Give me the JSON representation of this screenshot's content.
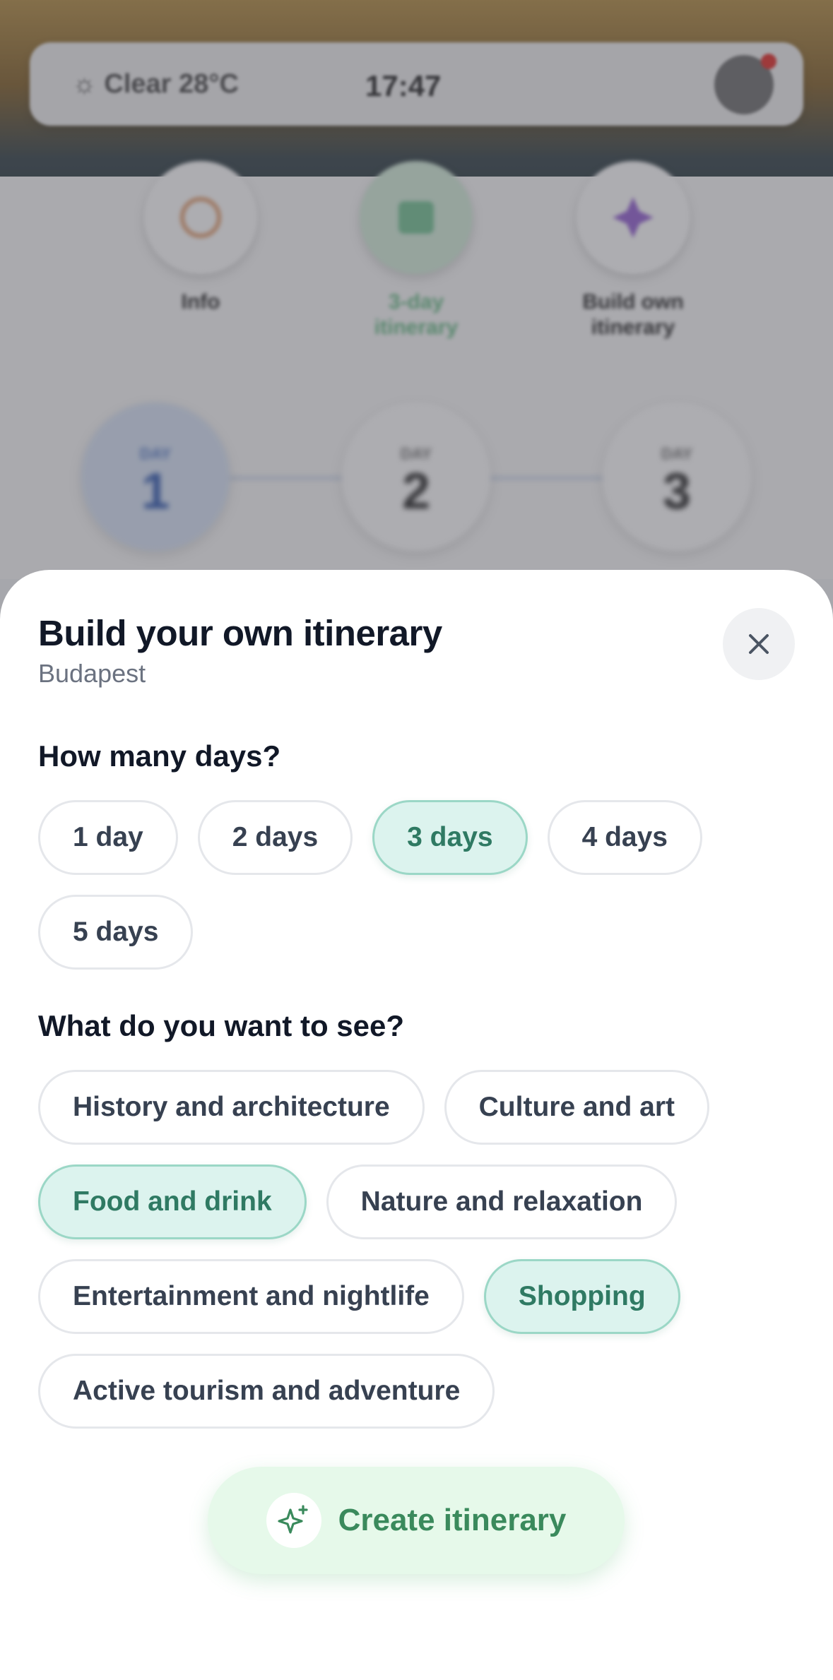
{
  "background": {
    "weather": "☼ Clear 28°C",
    "time": "17:47",
    "actions": [
      {
        "label": "Info",
        "icon": "info-icon",
        "color": "#e8b08a"
      },
      {
        "label": "3-day itinerary",
        "icon": "map-icon",
        "color": "#7cc79a"
      },
      {
        "label": "Build own itinerary",
        "icon": "sparkle-icon",
        "color": "#9b6ad6"
      }
    ],
    "days": [
      {
        "label": "DAY",
        "number": "1"
      },
      {
        "label": "DAY",
        "number": "2"
      },
      {
        "label": "DAY",
        "number": "3"
      }
    ]
  },
  "sheet": {
    "title": "Build your own itinerary",
    "subtitle": "Budapest",
    "close_icon": "close-icon",
    "days_question": "How many days?",
    "day_options": [
      {
        "label": "1 day",
        "selected": false
      },
      {
        "label": "2 days",
        "selected": false
      },
      {
        "label": "3 days",
        "selected": true
      },
      {
        "label": "4 days",
        "selected": false
      },
      {
        "label": "5 days",
        "selected": false
      }
    ],
    "interests_question": "What do you want to see?",
    "interest_options": [
      {
        "label": "History and architecture",
        "selected": false
      },
      {
        "label": "Culture and art",
        "selected": false
      },
      {
        "label": "Food and drink",
        "selected": true
      },
      {
        "label": "Nature and relaxation",
        "selected": false
      },
      {
        "label": "Entertainment and nightlife",
        "selected": false
      },
      {
        "label": "Shopping",
        "selected": true
      },
      {
        "label": "Active tourism and adventure",
        "selected": false
      }
    ],
    "create_button": {
      "label": "Create itinerary",
      "icon": "sparkle-icon"
    }
  },
  "colors": {
    "accent": "#2f7a63",
    "accent_bg": "#dcf3ee",
    "cta_bg": "#e6f9ea",
    "cta_text": "#3a8a5c"
  }
}
